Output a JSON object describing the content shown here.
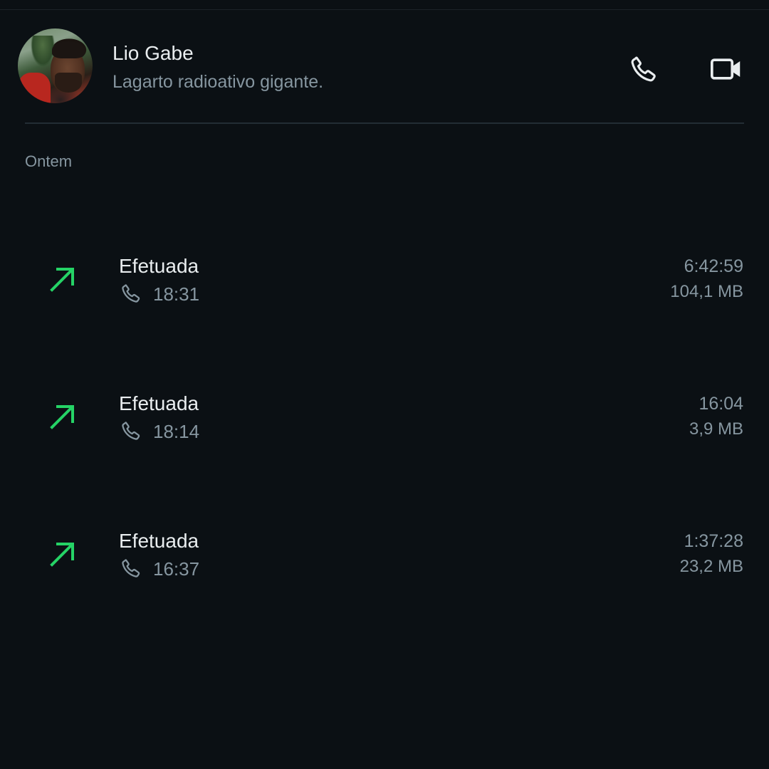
{
  "contact": {
    "name": "Lio Gabe",
    "status": "Lagarto radioativo gigante."
  },
  "section": {
    "label": "Ontem"
  },
  "calls": [
    {
      "type": "Efetuada",
      "time": "18:31",
      "duration": "6:42:59",
      "size": "104,1 MB",
      "direction_icon": "outgoing-arrow-icon"
    },
    {
      "type": "Efetuada",
      "time": "18:14",
      "duration": "16:04",
      "size": "3,9 MB",
      "direction_icon": "outgoing-arrow-icon"
    },
    {
      "type": "Efetuada",
      "time": "16:37",
      "duration": "1:37:28",
      "size": "23,2 MB",
      "direction_icon": "outgoing-arrow-icon"
    }
  ],
  "colors": {
    "background": "#0b1014",
    "outgoing": "#25d366",
    "primary_text": "#e9edef",
    "secondary_text": "#8696a0"
  }
}
